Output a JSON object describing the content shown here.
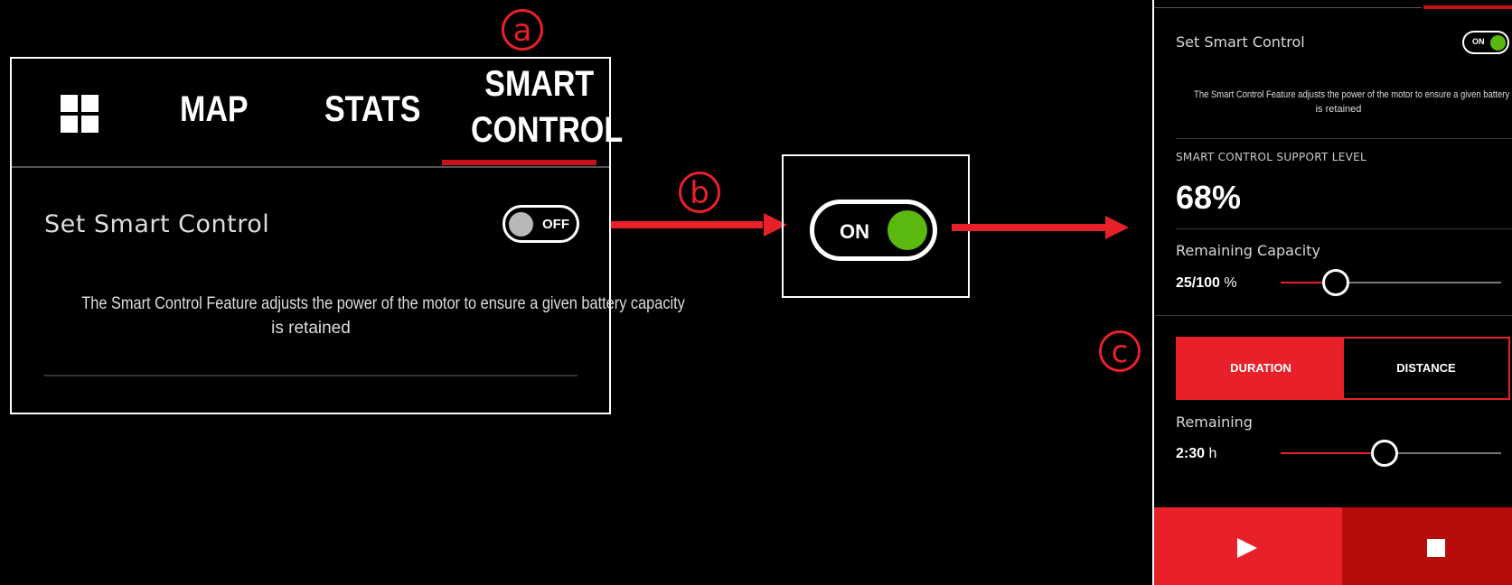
{
  "annotations": {
    "a": "a",
    "b": "b",
    "c": "c"
  },
  "left_panel": {
    "tabs": [
      {
        "label_line1": "MAP"
      },
      {
        "label_line1": "STATS"
      },
      {
        "label_line1": "SMART",
        "label_line2": "CONTROL",
        "active": true
      }
    ],
    "set_smart_control_label": "Set Smart Control",
    "toggle_state": "OFF",
    "description_line1": "The Smart Control Feature adjusts the power of the motor to ensure a given battery capacity",
    "description_line2": "is retained"
  },
  "middle_toggle": {
    "state": "ON"
  },
  "right_panel": {
    "set_smart_control_label": "Set Smart Control",
    "toggle_state": "ON",
    "description_line1": "The Smart Control Feature adjusts the power of the motor to ensure a given battery capacity",
    "description_line2": "is retained",
    "support_level_label": "SMART CONTROL SUPPORT LEVEL",
    "support_level_value": "68%",
    "remaining_capacity_label": "Remaining Capacity",
    "remaining_capacity_value": "25/100",
    "remaining_capacity_unit": "%",
    "remaining_capacity_fraction": 0.25,
    "mode_buttons": {
      "duration": "DURATION",
      "distance": "DISTANCE",
      "selected": "DURATION"
    },
    "remaining_label": "Remaining",
    "remaining_value": "2:30",
    "remaining_unit": "h",
    "remaining_fraction": 0.47
  },
  "colors": {
    "accent": "#e8202a",
    "accent_dark": "#b80c0c",
    "toggle_on": "#5ab80e",
    "toggle_off": "#b8b8b8"
  },
  "icons": [
    "grid-icon",
    "play-icon",
    "stop-icon"
  ]
}
